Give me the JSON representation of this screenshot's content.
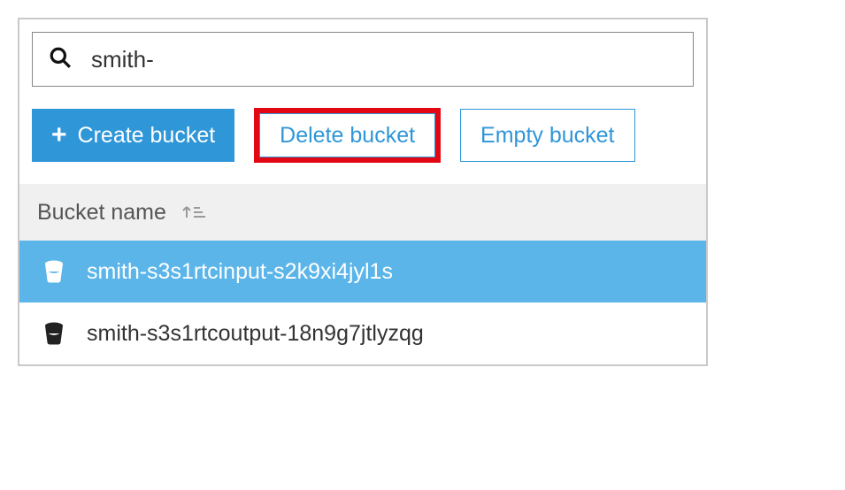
{
  "search": {
    "value": "smith-"
  },
  "actions": {
    "create_label": "Create bucket",
    "delete_label": "Delete bucket",
    "empty_label": "Empty bucket"
  },
  "table": {
    "header_label": "Bucket name"
  },
  "buckets": [
    {
      "name": "smith-s3s1rtcinput-s2k9xi4jyl1s",
      "selected": true
    },
    {
      "name": "smith-s3s1rtcoutput-18n9g7jtlyzqg",
      "selected": false
    }
  ]
}
